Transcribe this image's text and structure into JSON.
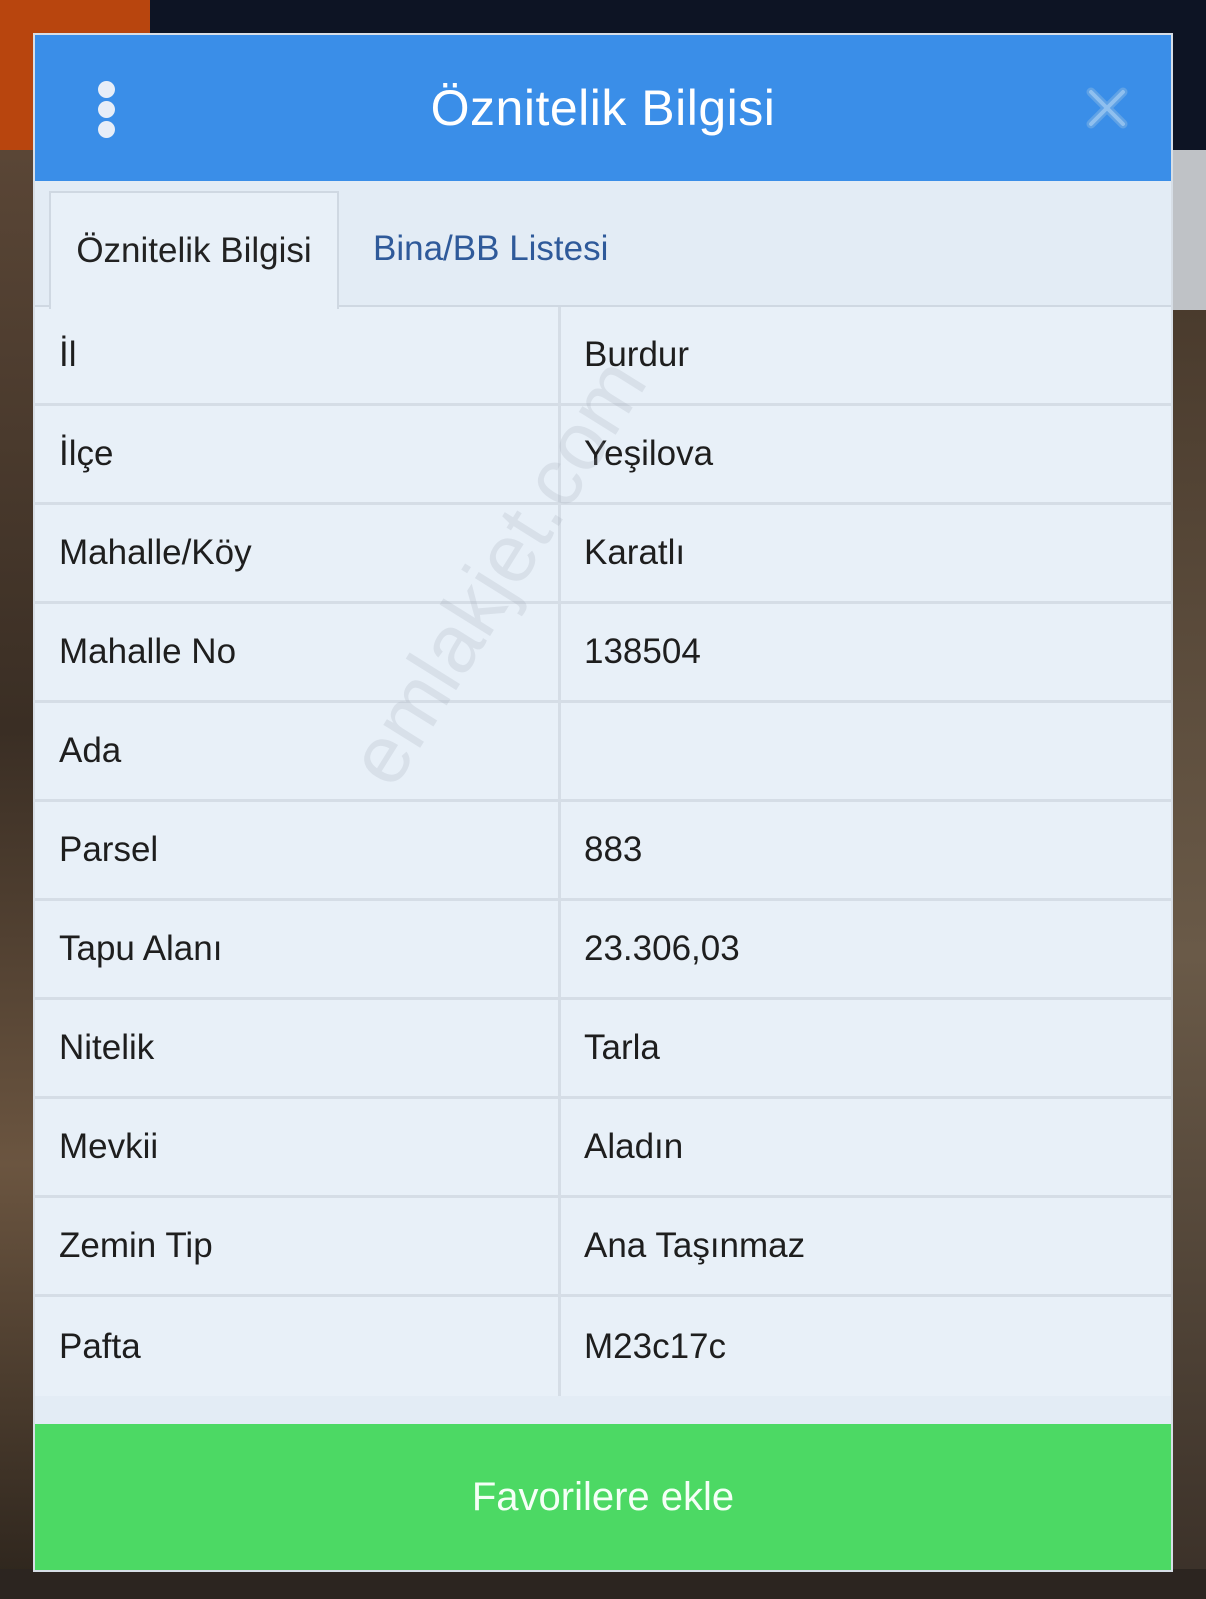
{
  "dialog": {
    "title": "Öznitelik Bilgisi",
    "menu_icon": "more-vertical-icon",
    "close_icon": "close-icon"
  },
  "tabs": [
    {
      "label": "Öznitelik Bilgisi",
      "active": true
    },
    {
      "label": "Bina/BB Listesi",
      "active": false
    }
  ],
  "attributes": [
    {
      "label": "İl",
      "value": "Burdur"
    },
    {
      "label": "İlçe",
      "value": "Yeşilova"
    },
    {
      "label": "Mahalle/Köy",
      "value": "Karatlı"
    },
    {
      "label": "Mahalle No",
      "value": "138504"
    },
    {
      "label": "Ada",
      "value": ""
    },
    {
      "label": "Parsel",
      "value": "883"
    },
    {
      "label": "Tapu Alanı",
      "value": "23.306,03"
    },
    {
      "label": "Nitelik",
      "value": "Tarla"
    },
    {
      "label": "Mevkii",
      "value": "Aladın"
    },
    {
      "label": "Zemin Tip",
      "value": "Ana Taşınmaz"
    },
    {
      "label": "Pafta",
      "value": "M23c17c"
    }
  ],
  "footer": {
    "button_label": "Favorilere ekle"
  },
  "watermark": "emlakjet.com",
  "colors": {
    "header": "#3a8ee8",
    "footer": "#4cd964",
    "panel": "#e8f0f8",
    "tab_inactive_text": "#2f5a9a"
  }
}
